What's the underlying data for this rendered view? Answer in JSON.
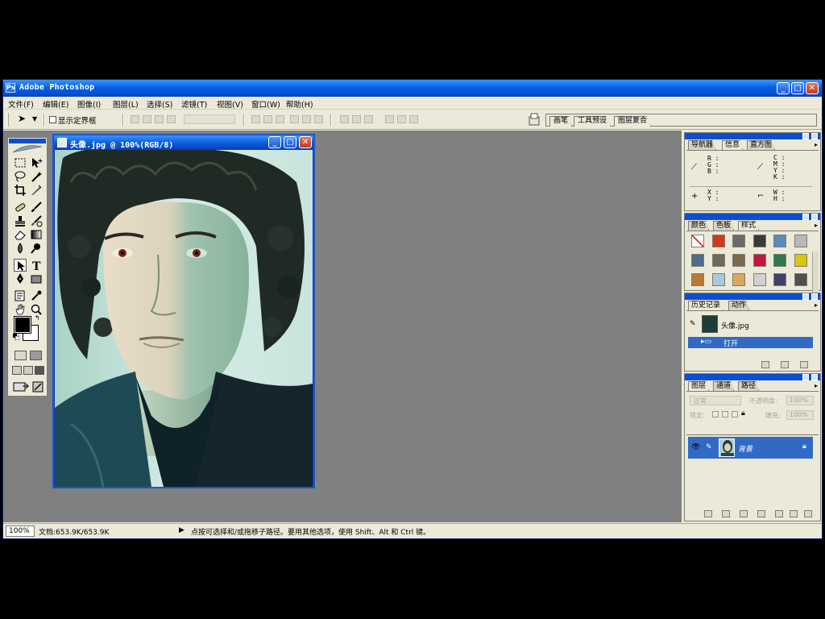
{
  "window": {
    "title": "Adobe Photoshop"
  },
  "menu": [
    "文件(F)",
    "编辑(E)",
    "图像(I)",
    "图层(L)",
    "选择(S)",
    "滤镜(T)",
    "视图(V)",
    "窗口(W)",
    "帮助(H)"
  ],
  "options": {
    "show_bounding_box": "显示定界框",
    "show_bounding_box_checked": false
  },
  "palette_well": {
    "tabs": [
      "画笔",
      "工具预设",
      "图层复合"
    ]
  },
  "document": {
    "title": "头像.jpg @ 100%(RGB/8)"
  },
  "navigator_panel": {
    "tabs": [
      "导航器",
      "信息",
      "直方图"
    ],
    "active_tab": "信息",
    "rgb_label": "R :\nG :\nB :",
    "cmyk_label": "C :\nM :\nY :\nK :",
    "xy_label": "X :\nY :",
    "wh_label": "W :\nH :"
  },
  "color_panel": {
    "tabs": [
      "颜色",
      "色板",
      "样式"
    ],
    "active_tab": "样式",
    "style_swatches": [
      "#ffffff",
      "#d4381c",
      "#6a6a6a",
      "#3a3a3a",
      "#5a8ab8",
      "#b8b8b8",
      "#4f6a8a",
      "#6e6a5a",
      "#7a6a50",
      "#c01840",
      "#2f7a4a",
      "#d8c800",
      "#b87a3a",
      "#a8c8e0",
      "#d8a860",
      "#d0d0d0",
      "#40406a",
      "#505050"
    ]
  },
  "history_panel": {
    "tabs": [
      "历史记录",
      "动作"
    ],
    "active_tab": "历史记录",
    "snapshot": "头像.jpg",
    "steps": [
      "打开"
    ]
  },
  "layers_panel": {
    "tabs": [
      "图层",
      "通道",
      "路径"
    ],
    "active_tab": "图层",
    "blend_mode": "正常",
    "opacity_label": "不透明度:",
    "opacity_value": "100%",
    "lock_label": "锁定:",
    "fill_label": "填充:",
    "fill_value": "100%",
    "layers": [
      "背景"
    ]
  },
  "status": {
    "zoom": "100%",
    "doc_size": "文档:653.9K/653.9K",
    "message": "点按可选择和/或拖移子路径。要用其他选项，使用 Shift、Alt 和 Ctrl 键。"
  }
}
